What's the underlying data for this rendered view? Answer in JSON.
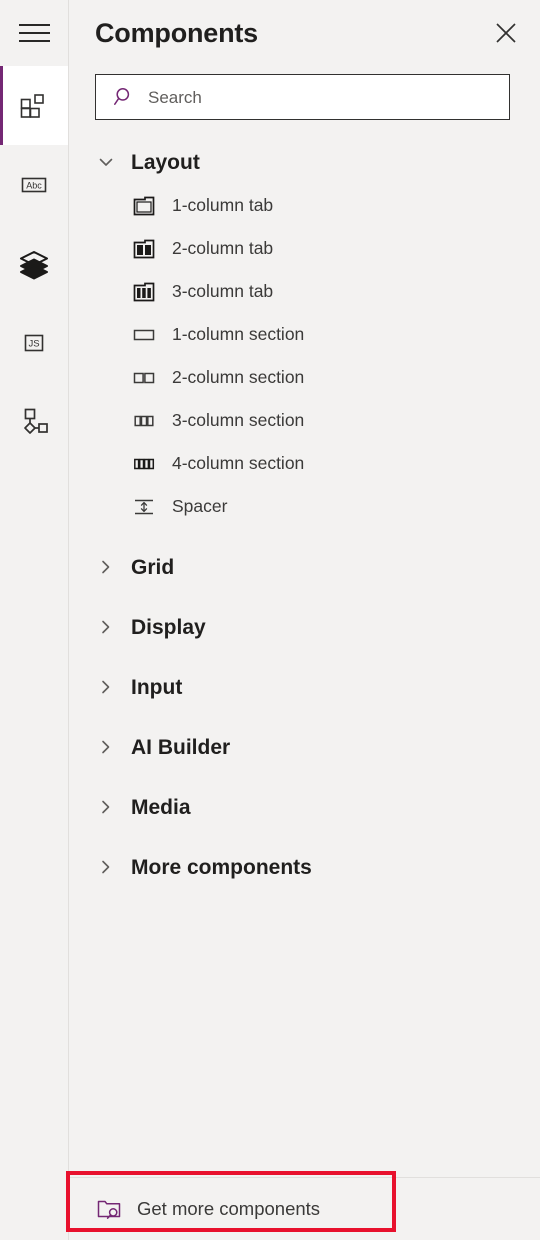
{
  "colors": {
    "accent": "#742774",
    "highlight": "#e8112d",
    "panel_bg": "#f3f2f1",
    "selected_bg": "#ffffff",
    "text_primary": "#201f1e",
    "text_secondary": "#3b3a39",
    "placeholder": "#605e5c",
    "divider": "#e1dfdd",
    "icon_dark": "#292827"
  },
  "rail": {
    "menu_button": {
      "icon": "hamburger-icon",
      "label": "Menu"
    },
    "items": [
      {
        "id": "components",
        "icon": "components-grid-icon",
        "label": "Components",
        "selected": true
      },
      {
        "id": "properties",
        "icon": "abc-text-icon",
        "label": "Properties",
        "selected": false
      },
      {
        "id": "layers",
        "icon": "layers-stack-icon",
        "label": "Layers",
        "selected": false
      },
      {
        "id": "code",
        "icon": "js-code-icon",
        "label": "Code",
        "selected": false
      },
      {
        "id": "flow",
        "icon": "node-flow-icon",
        "label": "Flow",
        "selected": false
      }
    ]
  },
  "header": {
    "title": "Components",
    "close_icon": "close-icon",
    "close_label": "Close"
  },
  "search": {
    "icon": "search-icon",
    "placeholder": "Search",
    "value": ""
  },
  "tree": {
    "groups": [
      {
        "id": "layout",
        "label": "Layout",
        "expanded": true,
        "chevron": "chevron-down-icon",
        "items": [
          {
            "id": "1-column-tab",
            "label": "1-column tab",
            "icon": "tab-1col-icon",
            "cols": 1,
            "shape": "tab"
          },
          {
            "id": "2-column-tab",
            "label": "2-column tab",
            "icon": "tab-2col-icon",
            "cols": 2,
            "shape": "tab"
          },
          {
            "id": "3-column-tab",
            "label": "3-column tab",
            "icon": "tab-3col-icon",
            "cols": 3,
            "shape": "tab"
          },
          {
            "id": "1-column-section",
            "label": "1-column section",
            "icon": "section-1col-icon",
            "cols": 1,
            "shape": "section"
          },
          {
            "id": "2-column-section",
            "label": "2-column section",
            "icon": "section-2col-icon",
            "cols": 2,
            "shape": "section"
          },
          {
            "id": "3-column-section",
            "label": "3-column section",
            "icon": "section-3col-icon",
            "cols": 3,
            "shape": "section"
          },
          {
            "id": "4-column-section",
            "label": "4-column section",
            "icon": "section-4col-icon",
            "cols": 4,
            "shape": "section"
          },
          {
            "id": "spacer",
            "label": "Spacer",
            "icon": "spacer-icon",
            "cols": 0,
            "shape": "spacer"
          }
        ]
      },
      {
        "id": "grid",
        "label": "Grid",
        "expanded": false,
        "chevron": "chevron-right-icon",
        "items": []
      },
      {
        "id": "display",
        "label": "Display",
        "expanded": false,
        "chevron": "chevron-right-icon",
        "items": []
      },
      {
        "id": "input",
        "label": "Input",
        "expanded": false,
        "chevron": "chevron-right-icon",
        "items": []
      },
      {
        "id": "ai-builder",
        "label": "AI Builder",
        "expanded": false,
        "chevron": "chevron-right-icon",
        "items": []
      },
      {
        "id": "media",
        "label": "Media",
        "expanded": false,
        "chevron": "chevron-right-icon",
        "items": []
      },
      {
        "id": "more-components",
        "label": "More components",
        "expanded": false,
        "chevron": "chevron-right-icon",
        "items": []
      }
    ]
  },
  "footer": {
    "get_more_label": "Get more components",
    "get_more_icon": "folder-search-icon",
    "highlighted": true
  }
}
